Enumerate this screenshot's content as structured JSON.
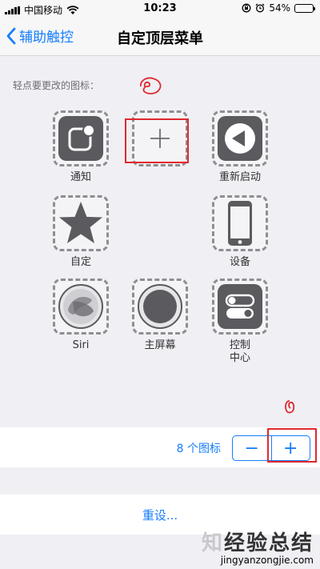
{
  "status_bar": {
    "carrier": "中国移动",
    "time": "10:23",
    "battery": "54%",
    "battery_level": 0.54
  },
  "nav": {
    "back_label": "辅助触控",
    "title": "自定顶层菜单"
  },
  "section_label": "轻点要更改的图标：",
  "grid": {
    "items": [
      {
        "label": "通知",
        "icon": "notification-icon"
      },
      {
        "label": "",
        "icon": "add-icon"
      },
      {
        "label": "重新启动",
        "icon": "restart-icon"
      },
      {
        "label": "自定",
        "icon": "star-icon"
      },
      {
        "label": "设备",
        "icon": "device-icon"
      },
      {
        "label": "Siri",
        "icon": "siri-icon"
      },
      {
        "label": "主屏幕",
        "icon": "home-button-icon"
      },
      {
        "label": "控制\n中心",
        "label_line1": "控制",
        "label_line2": "中心",
        "icon": "control-center-icon"
      }
    ]
  },
  "icon_count": {
    "label": "8 个图标",
    "minus": "−",
    "plus": "+"
  },
  "reset_label": "重设...",
  "watermark": {
    "brand_a": "知",
    "brand_b": "经验总结",
    "url": "jingyanzongjie.com"
  },
  "colors": {
    "accent": "#157efb",
    "annotation_red": "#e0282e",
    "tile_gray": "#5a5a5f"
  }
}
